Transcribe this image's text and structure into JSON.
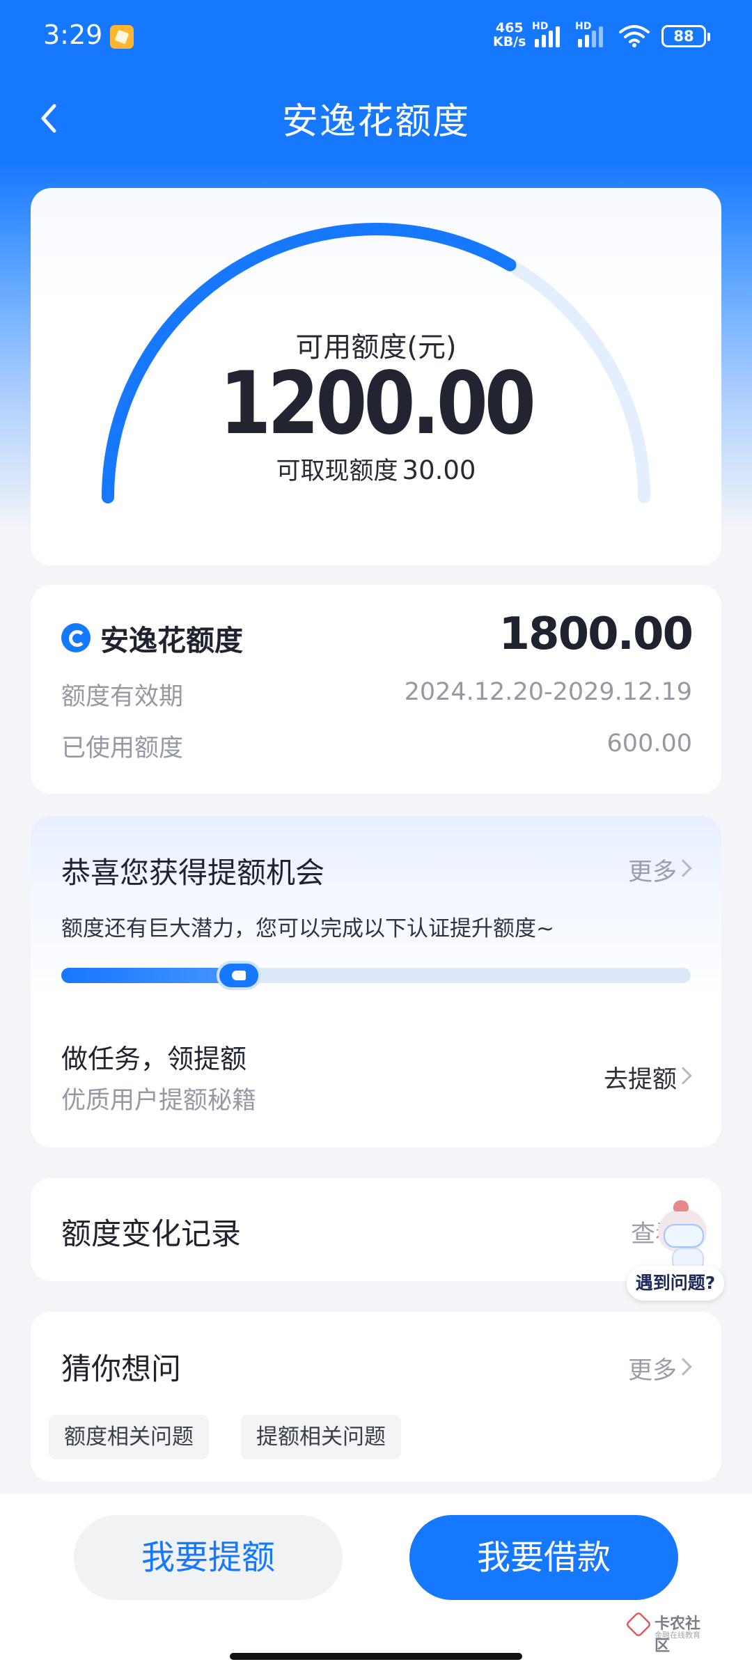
{
  "status_bar": {
    "time": "3:29",
    "net_speed_top": "465",
    "net_speed_bottom": "KB/s",
    "hd1": "HD",
    "hd2": "HD",
    "battery": "88"
  },
  "nav": {
    "title": "安逸花额度",
    "back_icon": "chevron-left-icon"
  },
  "gauge": {
    "label": "可用额度(元)",
    "available": "1200.00",
    "cash_label": "可取现额度",
    "cash_value": "30.00",
    "used_fraction": 0.6667,
    "colors": {
      "active": "#1677ff",
      "track": "#e3eeff"
    }
  },
  "credit": {
    "title": "安逸花额度",
    "total": "1800.00",
    "validity_label": "额度有效期",
    "validity_value": "2024.12.20-2029.12.19",
    "used_label": "已使用额度",
    "used_value": "600.00"
  },
  "upgrade": {
    "title": "恭喜您获得提额机会",
    "more": "更多",
    "desc": "额度还有巨大潜力，您可以完成以下认证提升额度~",
    "progress": 0.3,
    "task_title": "做任务，领提额",
    "task_sub": "优质用户提额秘籍",
    "task_action": "去提额"
  },
  "record": {
    "title": "额度变化记录",
    "view": "查看"
  },
  "helper": {
    "label": "遇到问题?"
  },
  "faq": {
    "title": "猜你想问",
    "more": "更多",
    "chips": [
      "额度相关问题",
      "提额相关问题"
    ]
  },
  "actions": {
    "raise": "我要提额",
    "borrow": "我要借款"
  },
  "watermark": {
    "name": "卡农社区",
    "sub": "金融在线教育"
  },
  "colors": {
    "brand": "#1677ff"
  }
}
